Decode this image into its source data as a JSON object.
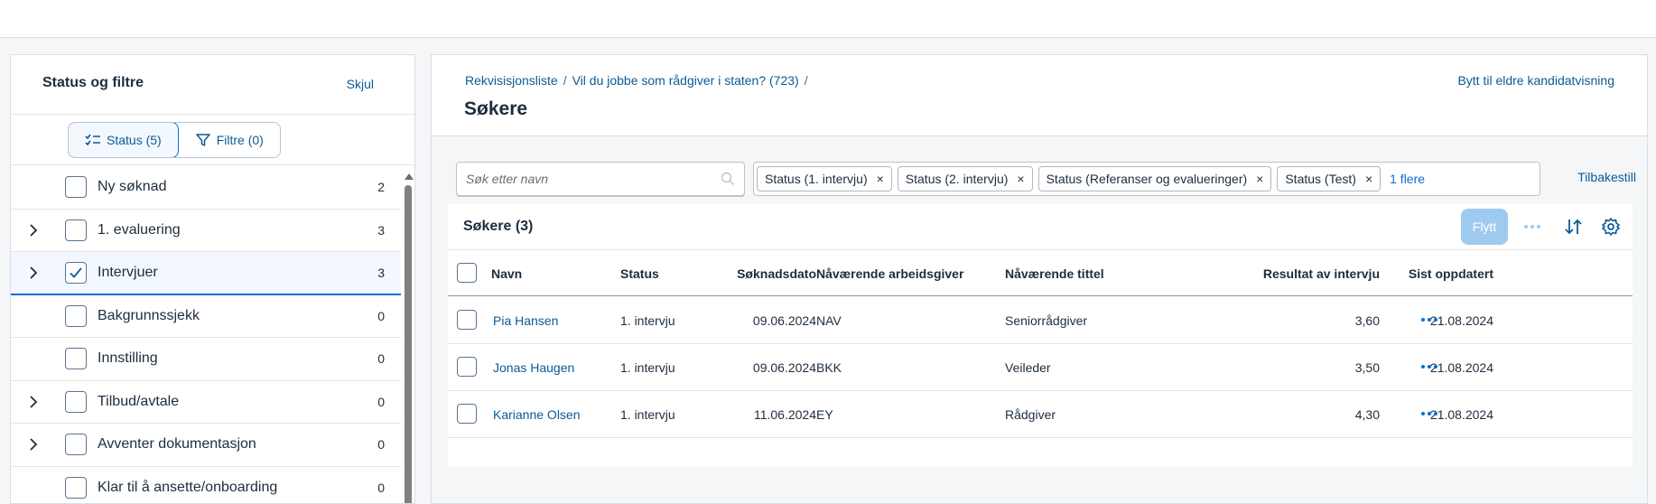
{
  "left_panel": {
    "title": "Status og filtre",
    "hide_label": "Skjul",
    "segments": [
      {
        "label": "Status (5)",
        "icon": "checklist-icon",
        "active": true
      },
      {
        "label": "Filtre (0)",
        "icon": "filter-icon",
        "active": false
      }
    ],
    "items": [
      {
        "label": "Ny søknad",
        "count": "2",
        "expandable": false,
        "checked": false,
        "selected": false
      },
      {
        "label": "1. evaluering",
        "count": "3",
        "expandable": true,
        "checked": false,
        "selected": false
      },
      {
        "label": "Intervjuer",
        "count": "3",
        "expandable": true,
        "checked": true,
        "selected": true
      },
      {
        "label": "Bakgrunnssjekk",
        "count": "0",
        "expandable": false,
        "checked": false,
        "selected": false
      },
      {
        "label": "Innstilling",
        "count": "0",
        "expandable": false,
        "checked": false,
        "selected": false
      },
      {
        "label": "Tilbud/avtale",
        "count": "0",
        "expandable": true,
        "checked": false,
        "selected": false
      },
      {
        "label": "Avventer dokumentasjon",
        "count": "0",
        "expandable": true,
        "checked": false,
        "selected": false
      },
      {
        "label": "Klar til å ansette/onboarding",
        "count": "0",
        "expandable": false,
        "checked": false,
        "selected": false
      }
    ]
  },
  "header": {
    "breadcrumbs": [
      "Rekvisisjonsliste",
      "Vil du jobbe som rådgiver i staten? (723)"
    ],
    "breadcrumb_sep": "/",
    "title": "Søkere",
    "switch_view_label": "Bytt til eldre kandidatvisning"
  },
  "filterbar": {
    "search_placeholder": "Søk etter navn",
    "tokens": [
      "Status (1. intervju)",
      "Status (2. intervju)",
      "Status (Referanser og evalueringer)",
      "Status (Test)"
    ],
    "token_close": "×",
    "more_label": "1 flere",
    "reset_label": "Tilbakestill"
  },
  "table": {
    "title": "Søkere (3)",
    "move_button": "Flytt",
    "columns": {
      "name": "Navn",
      "status": "Status",
      "date": "Søknadsdato",
      "employer": "Nåværende arbeidsgiver",
      "jobtitle": "Nåværende tittel",
      "result": "Resultat av intervju",
      "updated": "Sist oppdatert"
    },
    "rows": [
      {
        "name": "Pia Hansen",
        "status": "1. intervju",
        "date": "09.06.2024",
        "employer": "NAV",
        "jobtitle": "Seniorrådgiver",
        "result": "3,60",
        "updated": "21.08.2024"
      },
      {
        "name": "Jonas Haugen",
        "status": "1. intervju",
        "date": "09.06.2024",
        "employer": "BKK",
        "jobtitle": "Veileder",
        "result": "3,50",
        "updated": "21.08.2024"
      },
      {
        "name": "Karianne Olsen",
        "status": "1. intervju",
        "date": "11.06.2024",
        "employer": "EY",
        "jobtitle": "Rådgiver",
        "result": "4,30",
        "updated": "21.08.2024"
      }
    ]
  },
  "colors": {
    "link": "#0a5b96",
    "accent": "#0a6ed1",
    "disabled_button": "#9fcaef",
    "text": "#1d2d3e"
  }
}
